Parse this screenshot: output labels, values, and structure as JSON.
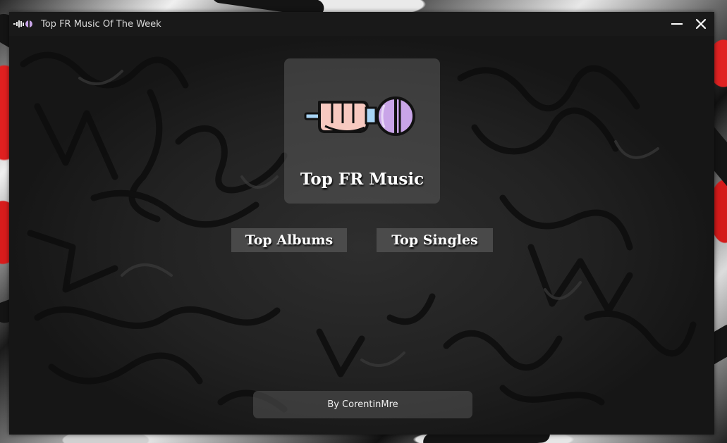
{
  "window": {
    "title": "Top FR Music Of The Week",
    "icon": "soundwave-logo-icon"
  },
  "logo": {
    "icon": "hand-microphone-icon",
    "title": "Top FR Music"
  },
  "nav": {
    "albums_label": "Top Albums",
    "singles_label": "Top Singles"
  },
  "footer": {
    "credit": "By CorentinMre"
  },
  "colors": {
    "accent_purple": "#c9a5e8",
    "accent_pink": "#f7c9c0",
    "accent_blue": "#a8d4f5",
    "desktop_red": "#e02020"
  }
}
